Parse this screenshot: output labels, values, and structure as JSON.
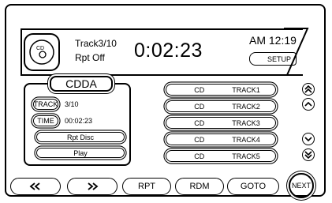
{
  "display": {
    "track": "Track3/10",
    "repeat": "Rpt Off",
    "time": "0:02:23",
    "clock": "AM 12:19",
    "setup_label": "SETUP",
    "disc_label": "CD"
  },
  "cdda": {
    "title": "CDDA",
    "track_label": "TRACK",
    "track_value": "3/10",
    "time_label": "TIME",
    "time_value": "00:02:23",
    "rpt_disc_label": "Rpt Disc",
    "play_label": "Play"
  },
  "tracks": [
    {
      "source": "CD",
      "name": "TRACK1"
    },
    {
      "source": "CD",
      "name": "TRACK2"
    },
    {
      "source": "CD",
      "name": "TRACK3"
    },
    {
      "source": "CD",
      "name": "TRACK4"
    },
    {
      "source": "CD",
      "name": "TRACK5"
    }
  ],
  "scroll": {
    "page_up_icon": "double-chevron-up-icon",
    "up_icon": "chevron-up-icon",
    "down_icon": "chevron-down-icon",
    "page_down_icon": "double-chevron-down-icon"
  },
  "bottom": {
    "prev_icon": "rewind-icon",
    "next_icon": "fast-forward-icon",
    "rpt_label": "RPT",
    "rdm_label": "RDM",
    "goto_label": "GOTO",
    "next_label": "NEXT"
  }
}
